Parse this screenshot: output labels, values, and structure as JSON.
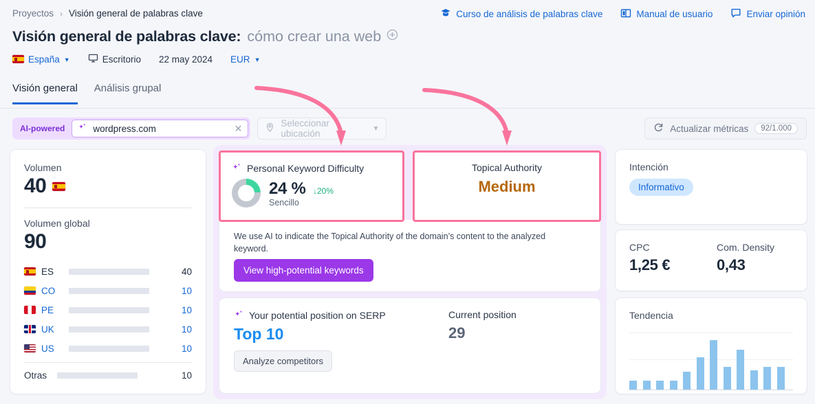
{
  "breadcrumb": {
    "root": "Proyectos",
    "separator": "›",
    "current": "Visión general de palabras clave"
  },
  "top_links": [
    {
      "label": "Curso de análisis de palabras clave",
      "icon": "graduation-cap-icon"
    },
    {
      "label": "Manual de usuario",
      "icon": "book-icon"
    },
    {
      "label": "Enviar opinión",
      "icon": "speech-bubble-icon"
    }
  ],
  "title": {
    "main": "Visión general de palabras clave:",
    "keyword": "cómo crear una web",
    "add_icon": "plus-circle-icon"
  },
  "filters": {
    "country": "España",
    "device": "Escritorio",
    "date": "22 may 2024",
    "currency": "EUR"
  },
  "tabs": [
    {
      "label": "Visión general",
      "active": true
    },
    {
      "label": "Análisis grupal",
      "active": false
    }
  ],
  "search": {
    "ai_badge": "AI-powered",
    "domain_value": "wordpress.com",
    "clear_icon": "close-icon",
    "sparkle_icon": "sparkle-icon",
    "location_placeholder": "Seleccionar ubicación",
    "location_icon": "map-pin-icon"
  },
  "refresh": {
    "label": "Actualizar métricas",
    "counter": "92/1.000",
    "icon": "refresh-icon"
  },
  "volume_card": {
    "label": "Volumen",
    "value": "40",
    "flag": "es",
    "global_label": "Volumen global",
    "global_value": "90",
    "rows": [
      {
        "code": "ES",
        "flag": "es",
        "value": "40",
        "pct": 100
      },
      {
        "code": "CO",
        "flag": "co",
        "value": "10",
        "pct": 25
      },
      {
        "code": "PE",
        "flag": "pe",
        "value": "10",
        "pct": 25
      },
      {
        "code": "UK",
        "flag": "uk",
        "value": "10",
        "pct": 25
      },
      {
        "code": "US",
        "flag": "us",
        "value": "10",
        "pct": 25
      }
    ],
    "other": {
      "code": "Otras",
      "value": "10",
      "pct": 25
    }
  },
  "pkd": {
    "title": "Personal Keyword Difficulty",
    "sparkle_icon": "sparkle-icon",
    "value": "24 %",
    "delta": "↓20%",
    "subtitle": "Sencillo",
    "donut_pct": 24
  },
  "topical_authority": {
    "label": "Topical Authority",
    "value": "Medium"
  },
  "ai_desc": "We use AI to indicate the Topical Authority of the domain’s content to the analyzed keyword.",
  "cta_button": "View high-potential keywords",
  "serp": {
    "potential_label": "Your potential position on SERP",
    "sparkle_icon": "sparkle-icon",
    "potential_value": "Top 10",
    "analyze_button": "Analyze competitors",
    "current_label": "Current position",
    "current_value": "29"
  },
  "intent": {
    "label": "Intención",
    "value": "Informativo"
  },
  "cpc": {
    "label": "CPC",
    "value": "1,25 €"
  },
  "com_density": {
    "label": "Com. Density",
    "value": "0,43"
  },
  "chart_data": {
    "type": "bar",
    "title": "Tendencia",
    "categories": [
      "1",
      "2",
      "3",
      "4",
      "5",
      "6",
      "7",
      "8",
      "9",
      "10",
      "11",
      "12"
    ],
    "values": [
      13,
      13,
      13,
      13,
      26,
      47,
      72,
      33,
      58,
      28,
      33,
      33
    ],
    "xlabel": "",
    "ylabel": "",
    "ylim": [
      0,
      78
    ],
    "grid": true,
    "legend": "none",
    "bar_color": "#8cc4ee"
  },
  "colors": {
    "accent_blue": "#1668d4",
    "ai_purple": "#9b38e8",
    "highlight_pink": "#f9749c",
    "topical_orange": "#b5680c",
    "donut_green": "#3ed6a0"
  }
}
